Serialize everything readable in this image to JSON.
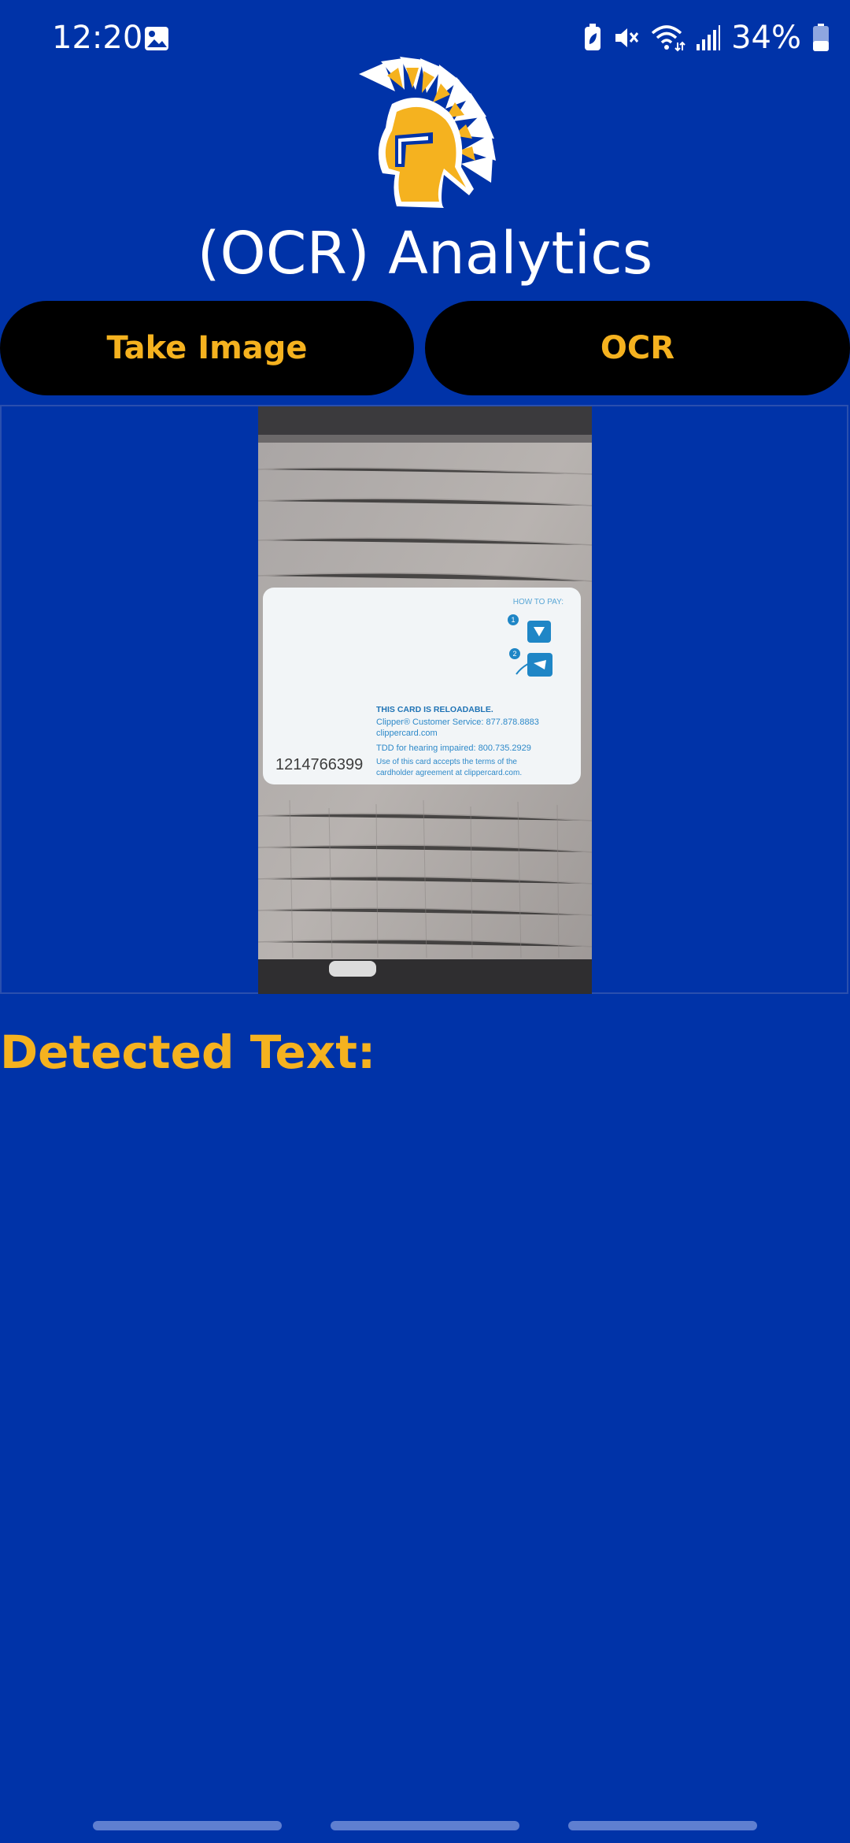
{
  "status_bar": {
    "time": "12:20",
    "battery_percent": "34%",
    "icons": [
      "gallery-icon",
      "battery-saver-icon",
      "mute-icon",
      "wifi-icon",
      "signal-icon",
      "battery-icon"
    ]
  },
  "header": {
    "title": "(OCR) Analytics",
    "logo_icon": "spartan-helmet-logo"
  },
  "buttons": {
    "take_image": "Take Image",
    "ocr": "OCR"
  },
  "photo": {
    "card_number": "1214766399",
    "how_to_pay": "HOW TO PAY:",
    "step_1": "1",
    "step_2": "2",
    "reloadable": "THIS CARD IS RELOADABLE.",
    "service": "Clipper® Customer Service: 877.878.8883",
    "website": "clippercard.com",
    "tdd": "TDD for hearing impaired: 800.735.2929",
    "terms_1": "Use of this card accepts the terms of the",
    "terms_2": "cardholder agreement at clippercard.com."
  },
  "detected": {
    "label": "Detected Text:",
    "value": ""
  },
  "colors": {
    "background": "#0033A8",
    "accent": "#F5B21F",
    "button_bg": "#000000",
    "text_light": "#FFFFFF"
  }
}
